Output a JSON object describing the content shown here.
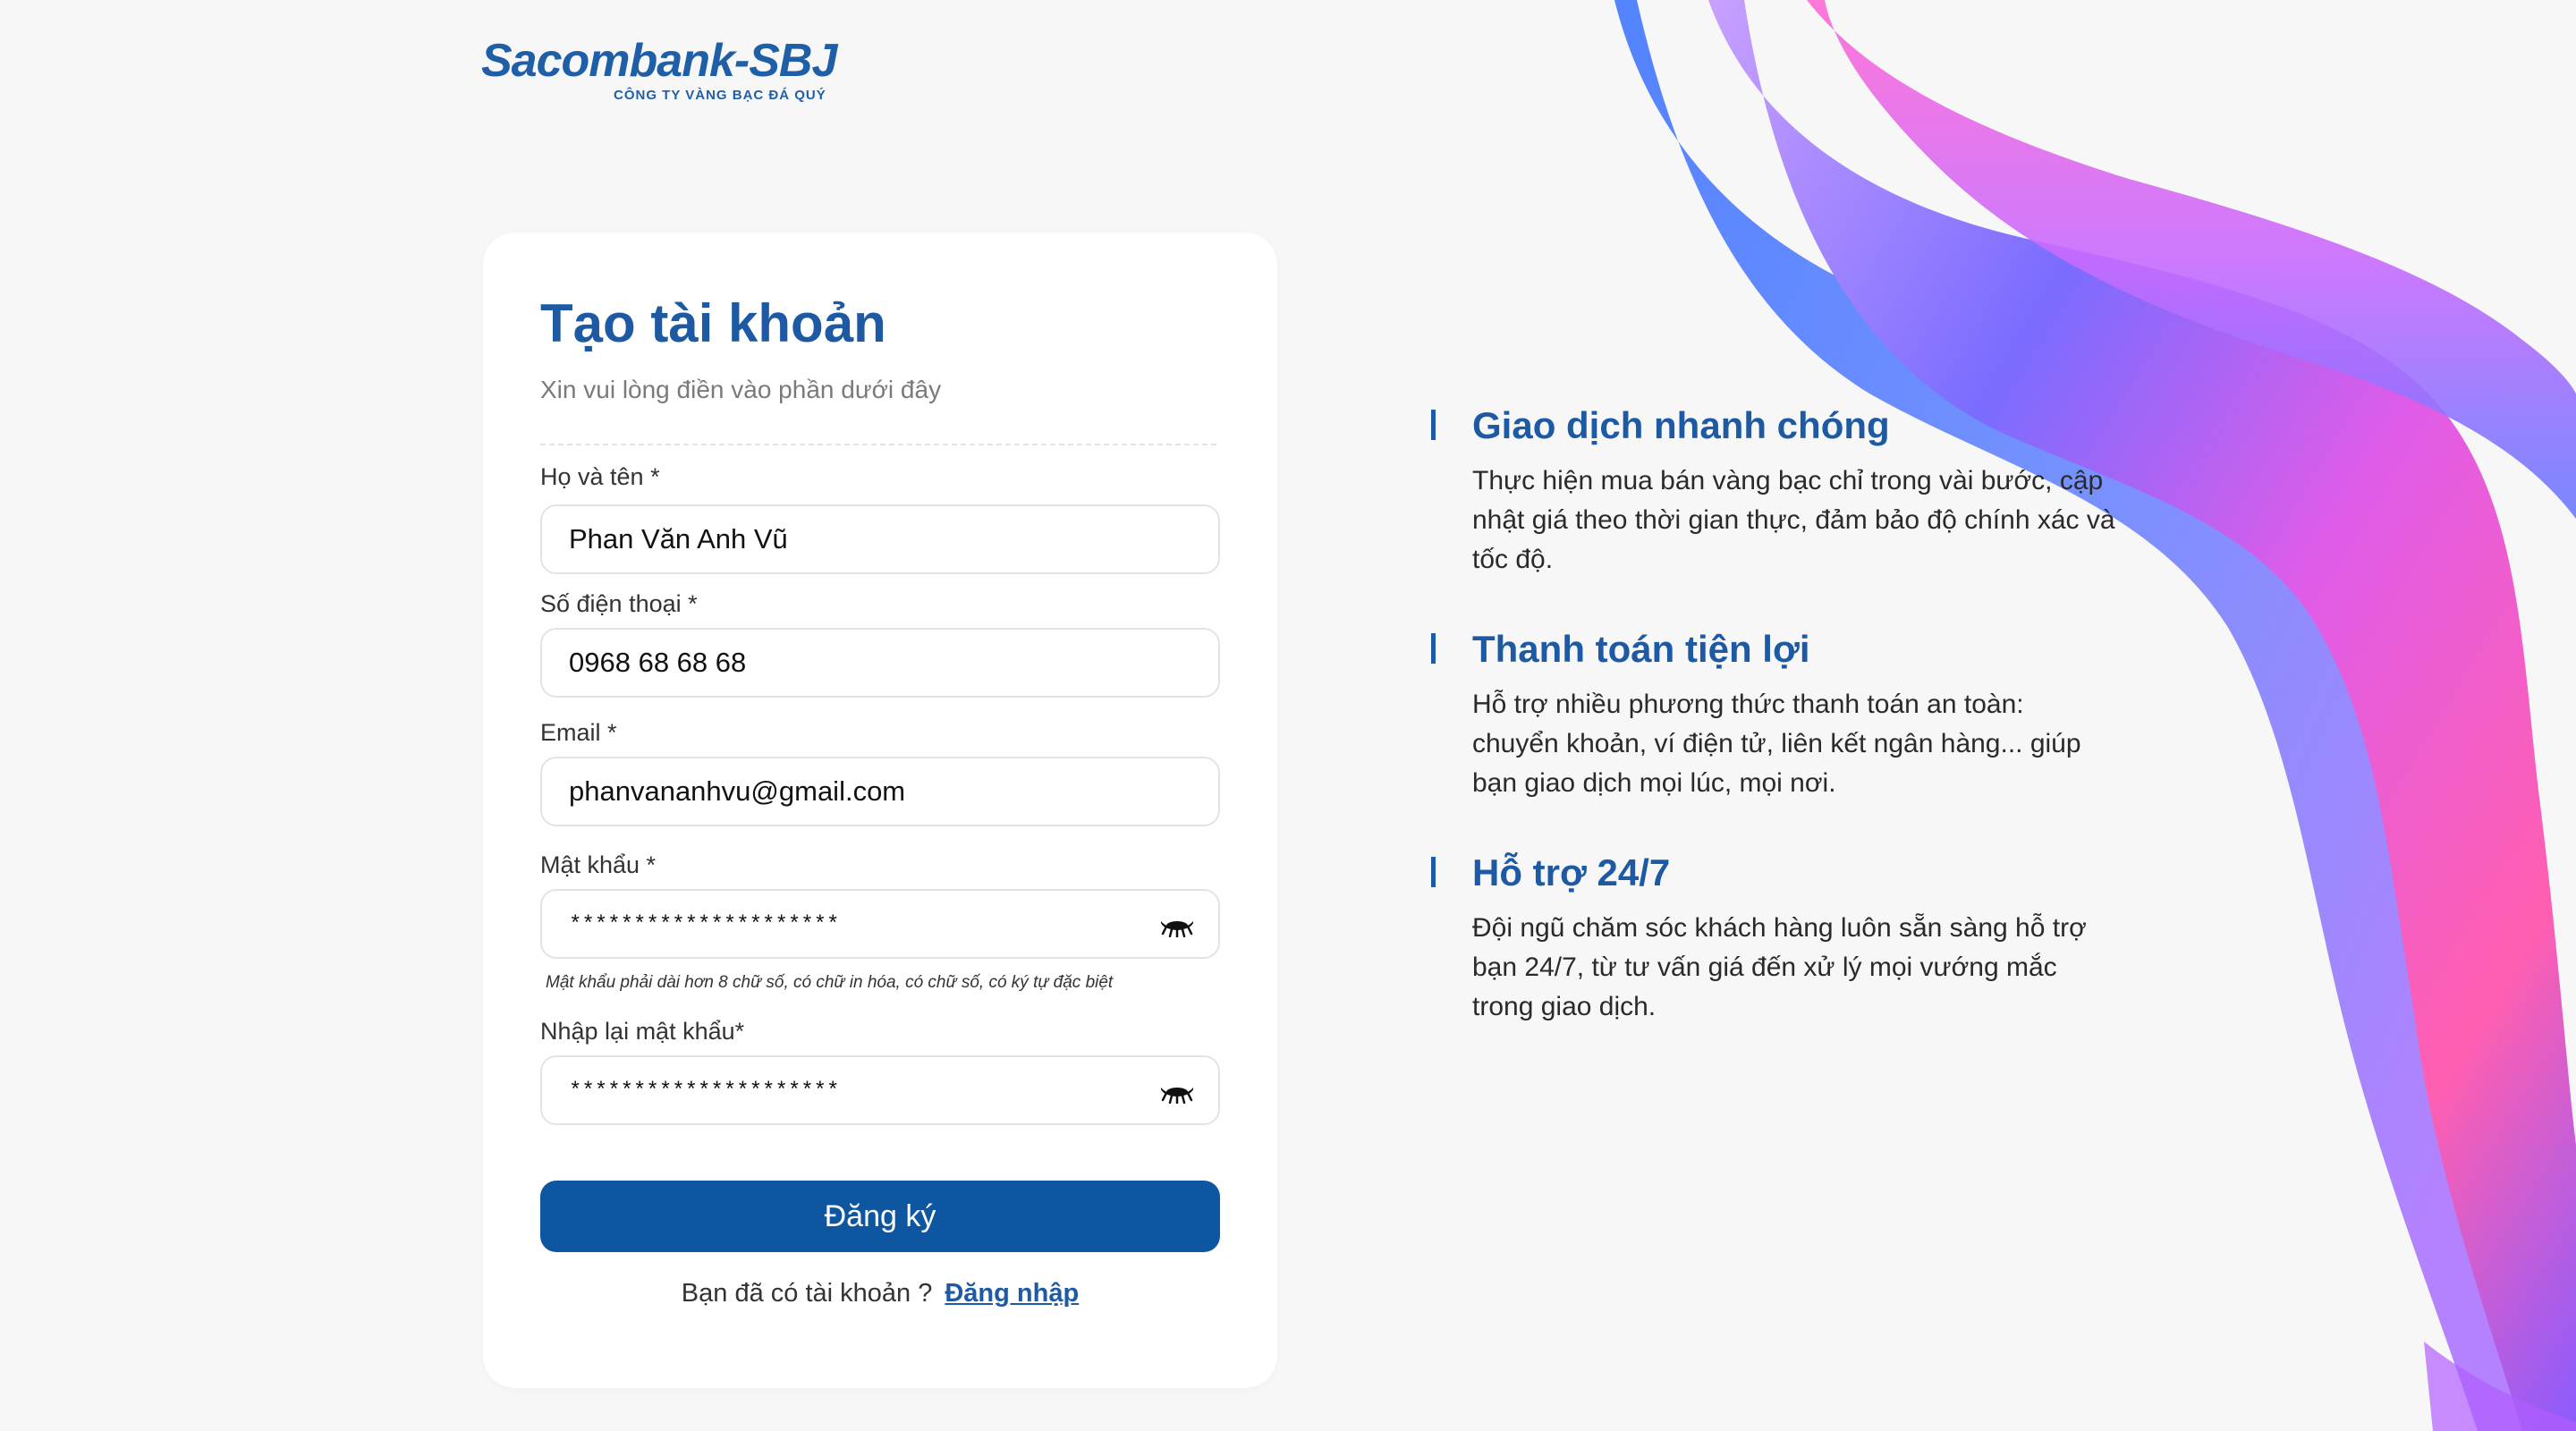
{
  "brand": {
    "name": "Sacombank-SBJ",
    "tagline": "CÔNG TY VÀNG BẠC ĐÁ QUÝ",
    "color": "#1f5fa8"
  },
  "form": {
    "title": "Tạo tài khoản",
    "subtitle": "Xin vui lòng điền vào phần dưới đây",
    "fullname": {
      "label": "Họ và tên *",
      "value": "Phan Văn Anh Vũ"
    },
    "phone": {
      "label": "Số điện thoại *",
      "value": "0968 68 68 68"
    },
    "email": {
      "label": "Email *",
      "value": "phanvananhvu@gmail.com"
    },
    "password": {
      "label": "Mật khẩu *",
      "value": "*********************",
      "hint": "Mật khẩu phải dài hơn 8 chữ số, có chữ in hóa, có chữ số, có ký tự đặc biệt"
    },
    "confirm_password": {
      "label": "Nhập lại mật khẩu*",
      "value": "*********************"
    },
    "submit_label": "Đăng ký",
    "login_prompt": "Bạn đã có tài khoản ?",
    "login_link": "Đăng nhập",
    "accent_color": "#0e56a0"
  },
  "features": [
    {
      "title": "Giao dịch nhanh chóng",
      "text": "Thực hiện mua bán vàng bạc chỉ trong vài bước, cập nhật giá theo thời gian thực, đảm bảo độ chính xác và tốc độ."
    },
    {
      "title": "Thanh toán tiện lợi",
      "text": "Hỗ trợ nhiều phương thức thanh toán an toàn: chuyển khoản, ví điện tử, liên kết ngân hàng... giúp bạn giao dịch mọi lúc, mọi nơi."
    },
    {
      "title": "Hỗ trợ 24/7",
      "text": "Đội ngũ chăm sóc khách hàng luôn sẵn sàng hỗ trợ bạn 24/7, từ tư vấn giá đến xử lý mọi vướng mắc trong giao dịch."
    }
  ],
  "icons": {
    "password_toggle": "eye-closed-icon",
    "decoration": "gradient-ribbon"
  }
}
